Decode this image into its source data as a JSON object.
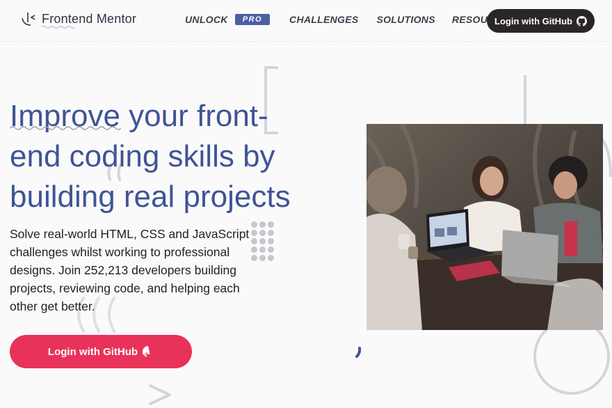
{
  "header": {
    "logo": {
      "icon": "frontend-mentor-logo-icon",
      "text": "Frontend Mentor"
    },
    "nav": {
      "unlock": "UNLOCK",
      "pro_badge": "PRO",
      "challenges": "CHALLENGES",
      "solutions": "SOLUTIONS",
      "resources": "RESOURCES"
    },
    "login_button": {
      "label": "Login with GitHub",
      "icon": "github-icon"
    }
  },
  "hero": {
    "title": "Improve your front-end coding skills by building real projects",
    "description": "Solve real-world HTML, CSS and JavaScript challenges whilst working to professional designs. Join 252,213 developers building projects, reviewing code, and helping each other get better.",
    "cta": {
      "label": "Login with GitHub",
      "icon": "github-icon"
    },
    "photo": {
      "icon": "people-coding-photo"
    }
  },
  "colors": {
    "accent": "#e8325a",
    "brand_blue": "#3f5496",
    "pro_badge": "#4c5fa3",
    "dark_button": "#2b2626"
  }
}
